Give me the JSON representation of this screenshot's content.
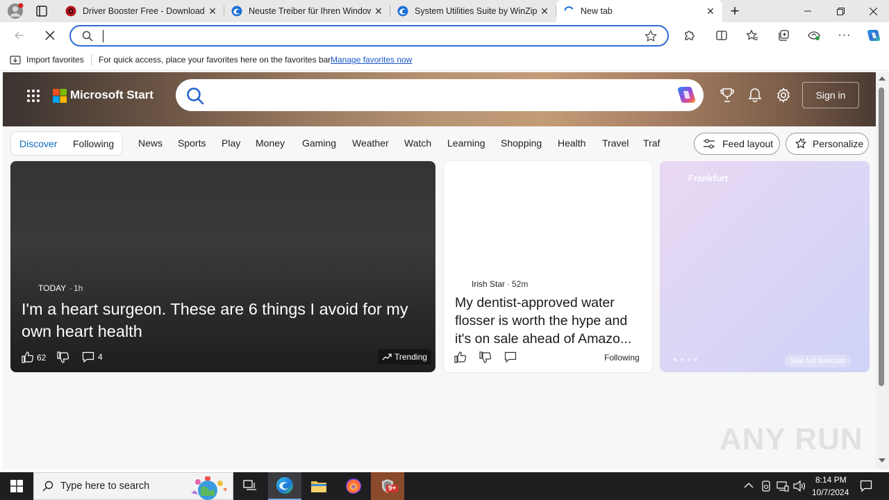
{
  "browser": {
    "tabs": [
      {
        "title": "Driver Booster Free - Download",
        "favicon": "driver-booster-icon",
        "active": false
      },
      {
        "title": "Neuste Treiber für Ihren Window",
        "favicon": "edge-page-icon",
        "active": false
      },
      {
        "title": "System Utilities Suite by WinZip",
        "favicon": "edge-page-icon",
        "active": false
      },
      {
        "title": "New tab",
        "favicon": "loading-spinner-icon",
        "active": true
      }
    ],
    "address_value": "",
    "favorites_bar": {
      "import_label": "Import favorites",
      "hint": "For quick access, place your favorites here on the favorites bar.",
      "manage_link": "Manage favorites now"
    }
  },
  "page": {
    "brand": "Microsoft Start",
    "signin_label": "Sign in",
    "nav": {
      "discover": "Discover",
      "following": "Following",
      "items": [
        "News",
        "Sports",
        "Play",
        "Money",
        "Gaming",
        "Weather",
        "Watch",
        "Learning",
        "Shopping",
        "Health",
        "Travel",
        "Traf"
      ],
      "feed_layout": "Feed layout",
      "personalize": "Personalize"
    },
    "cards": [
      {
        "source": "TODAY",
        "age": "1h",
        "headline": "I'm a heart surgeon. These are 6 things I avoid for my own heart health",
        "likes": "62",
        "comments": "4",
        "badge": "Trending"
      },
      {
        "source": "Irish Star",
        "age": "52m",
        "headline": "My dentist-approved water flosser is worth the hype and it's on sale ahead of Amazo...",
        "follow_label": "Following"
      }
    ],
    "weather": {
      "city": "Frankfurt",
      "forecast_link": "See full forecast"
    }
  },
  "taskbar": {
    "search_placeholder": "Type here to search",
    "time": "8:14 PM",
    "date": "10/7/2024",
    "badge": "9+"
  },
  "watermark": "ANY RUN",
  "colors": {
    "accent": "#2f6bd5",
    "discover_blue": "#0f6cbd",
    "taskbar": "#1f1f22"
  }
}
